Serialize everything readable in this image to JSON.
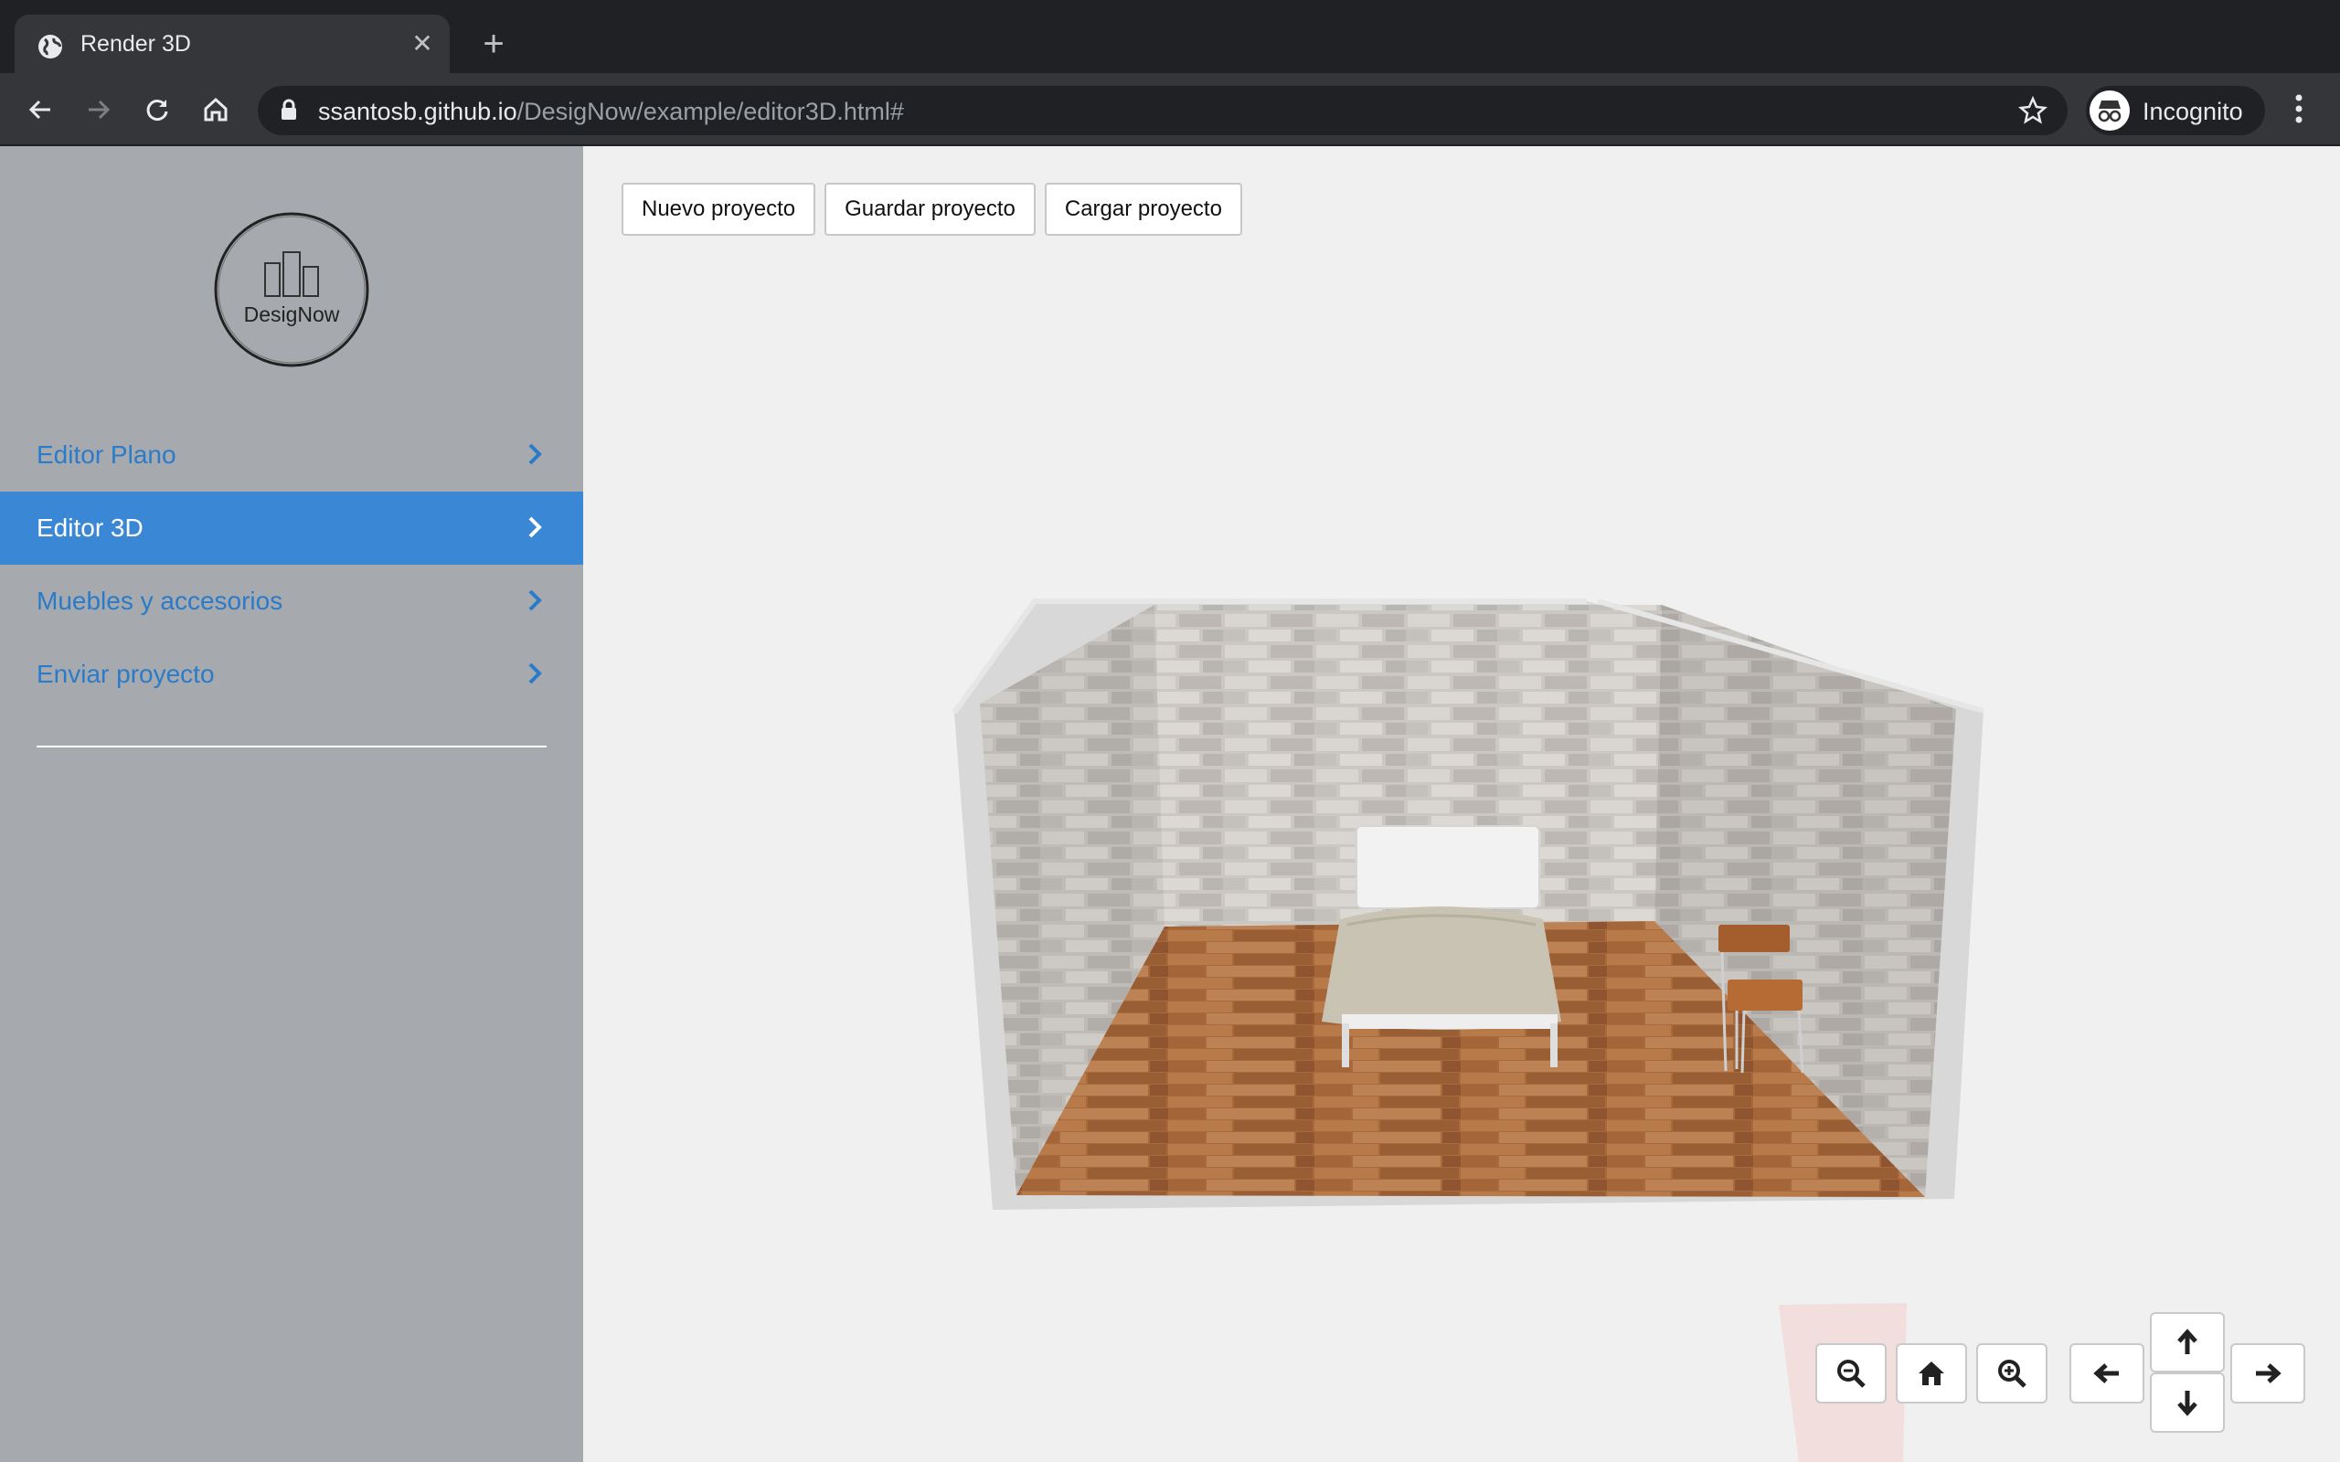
{
  "browser": {
    "tab_title": "Render 3D",
    "url_host": "ssantosb.github.io",
    "url_path": "/DesigNow/example/editor3D.html#",
    "profile_label": "Incognito"
  },
  "sidebar": {
    "logo_text": "DesigNow",
    "items": [
      {
        "label": "Editor Plano",
        "active": false
      },
      {
        "label": "Editor 3D",
        "active": true
      },
      {
        "label": "Muebles y accesorios",
        "active": false
      },
      {
        "label": "Enviar proyecto",
        "active": false
      }
    ]
  },
  "toolbar": {
    "new_label": "Nuevo proyecto",
    "save_label": "Guardar proyecto",
    "load_label": "Cargar proyecto"
  },
  "scene_controls": [
    "zoom-out-icon",
    "home-icon",
    "zoom-in-icon",
    "arrow-left-icon",
    "arrow-up-icon",
    "arrow-down-icon",
    "arrow-right-icon"
  ],
  "colors": {
    "sidebar_bg": "#a6a9ad",
    "link": "#2a7bc9",
    "active_bg": "#3a87d6",
    "floor": "#a9693a",
    "wall": "#c9c5c2"
  }
}
